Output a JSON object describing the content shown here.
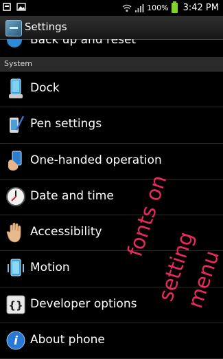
{
  "status_bar": {
    "battery": "100%",
    "time": "3:42 PM",
    "icons": [
      "settings-icon",
      "image-icon",
      "wifi-icon",
      "signal-icon",
      "battery-icon"
    ]
  },
  "title_bar": {
    "title": "Settings"
  },
  "partial_item": {
    "label": "Back up and reset"
  },
  "section_header": "System",
  "items": [
    {
      "label": "Dock",
      "icon": "dock-icon"
    },
    {
      "label": "Pen settings",
      "icon": "pen-icon"
    },
    {
      "label": "One-handed operation",
      "icon": "hand-phone-icon"
    },
    {
      "label": "Date and time",
      "icon": "clock-icon"
    },
    {
      "label": "Accessibility",
      "icon": "hand-icon"
    },
    {
      "label": "Motion",
      "icon": "motion-phone-icon"
    },
    {
      "label": "Developer options",
      "icon": "braces-icon"
    },
    {
      "label": "About phone",
      "icon": "info-icon"
    }
  ],
  "handwritten_note": {
    "color": "#e8295a"
  }
}
